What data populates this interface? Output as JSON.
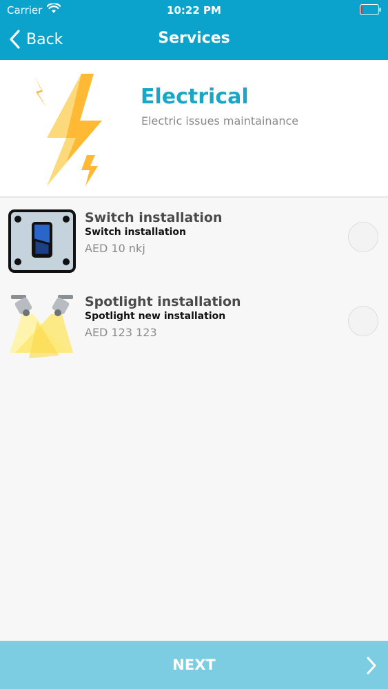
{
  "status_bar": {
    "carrier": "Carrier",
    "time": "10:22 PM"
  },
  "nav": {
    "back_label": "Back",
    "title": "Services"
  },
  "category": {
    "title": "Electrical",
    "subtitle": "Electric issues maintainance",
    "icon": "lightning-bolt-icon"
  },
  "services": [
    {
      "name": "Switch installation",
      "subtitle": "Switch installation",
      "price": "AED 10 nkj",
      "icon": "light-switch-icon",
      "selected": false
    },
    {
      "name": "Spotlight installation",
      "subtitle": "Spotlight new installation",
      "price": "AED 123 123",
      "icon": "spotlight-icon",
      "selected": false
    }
  ],
  "footer": {
    "next_label": "NEXT"
  },
  "colors": {
    "accent": "#0ba3cc",
    "title_teal": "#1aa6c6",
    "next_bar": "#7ccde2",
    "background": "#f7f7f7"
  }
}
